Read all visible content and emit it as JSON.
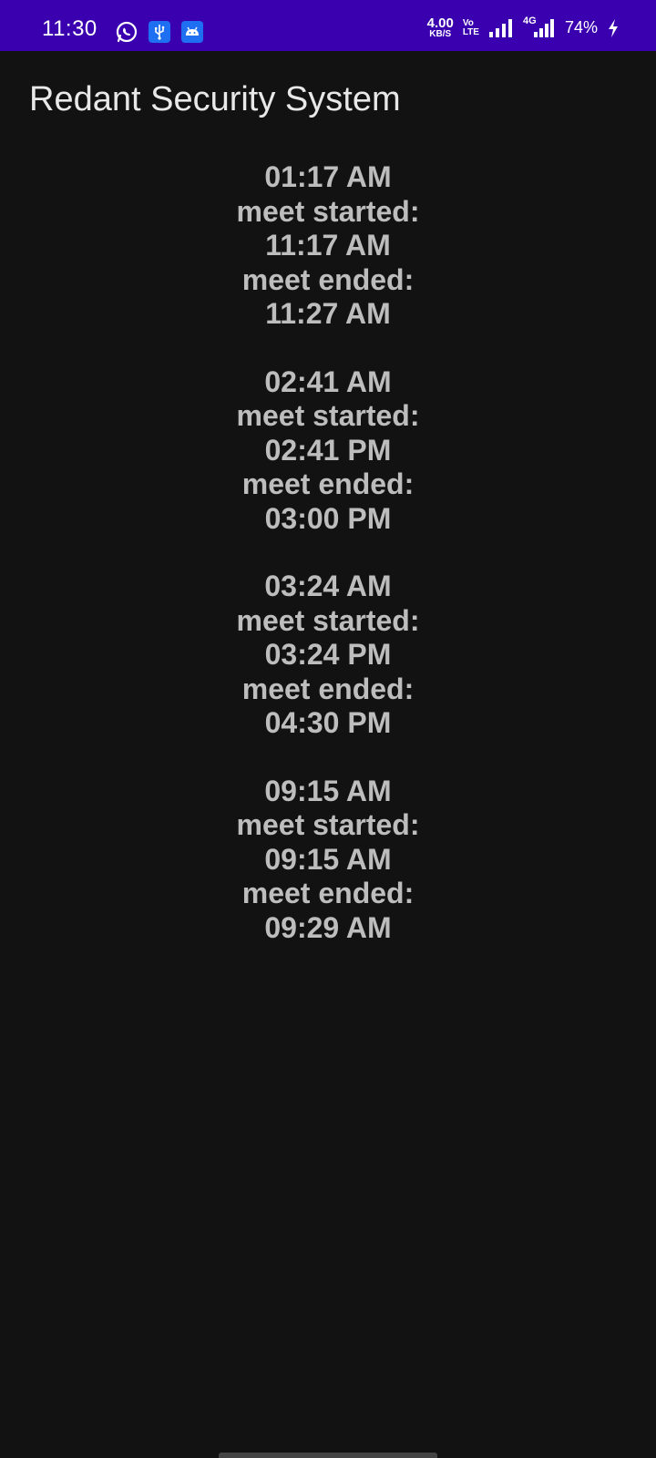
{
  "status_bar": {
    "time": "11:30",
    "net_speed_value": "4.00",
    "net_speed_unit": "KB/S",
    "volte_top": "Vo",
    "volte_bottom": "LTE",
    "network_type": "4G",
    "battery_percent": "74%",
    "icons": [
      "whatsapp-icon",
      "usb-icon",
      "android-debug-icon",
      "signal-icon",
      "signal-4g-icon",
      "charging-icon"
    ],
    "background": "#3a00b0"
  },
  "app": {
    "title": "Redant Security System"
  },
  "entries": [
    {
      "time": "01:17 AM",
      "started_label": "meet started:",
      "started": "11:17 AM",
      "ended_label": "meet ended:",
      "ended": "11:27 AM"
    },
    {
      "time": "02:41 AM",
      "started_label": "meet started:",
      "started": "02:41 PM",
      "ended_label": "meet ended:",
      "ended": "03:00 PM"
    },
    {
      "time": "03:24 AM",
      "started_label": "meet started:",
      "started": "03:24 PM",
      "ended_label": "meet ended:",
      "ended": "04:30 PM"
    },
    {
      "time": "09:15 AM",
      "started_label": "meet started:",
      "started": "09:15 AM",
      "ended_label": "meet ended:",
      "ended": "09:29 AM"
    }
  ]
}
